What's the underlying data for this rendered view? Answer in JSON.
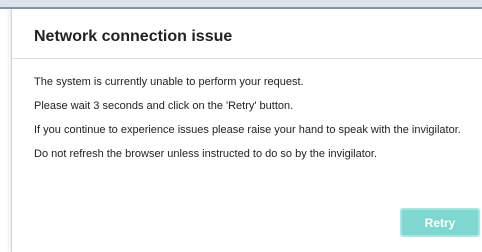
{
  "dialog": {
    "title": "Network connection issue",
    "messages": [
      "The system is currently unable to perform your request.",
      "Please wait 3 seconds and click on the 'Retry' button.",
      "If you continue to experience issues please raise your hand to speak with the invigilator.",
      "Do not refresh the browser unless instructed to do so by the invigilator."
    ],
    "retry_label": "Retry"
  },
  "colors": {
    "accent": "#7ed8d0",
    "text": "#222222",
    "divider": "#dcdfe2"
  }
}
